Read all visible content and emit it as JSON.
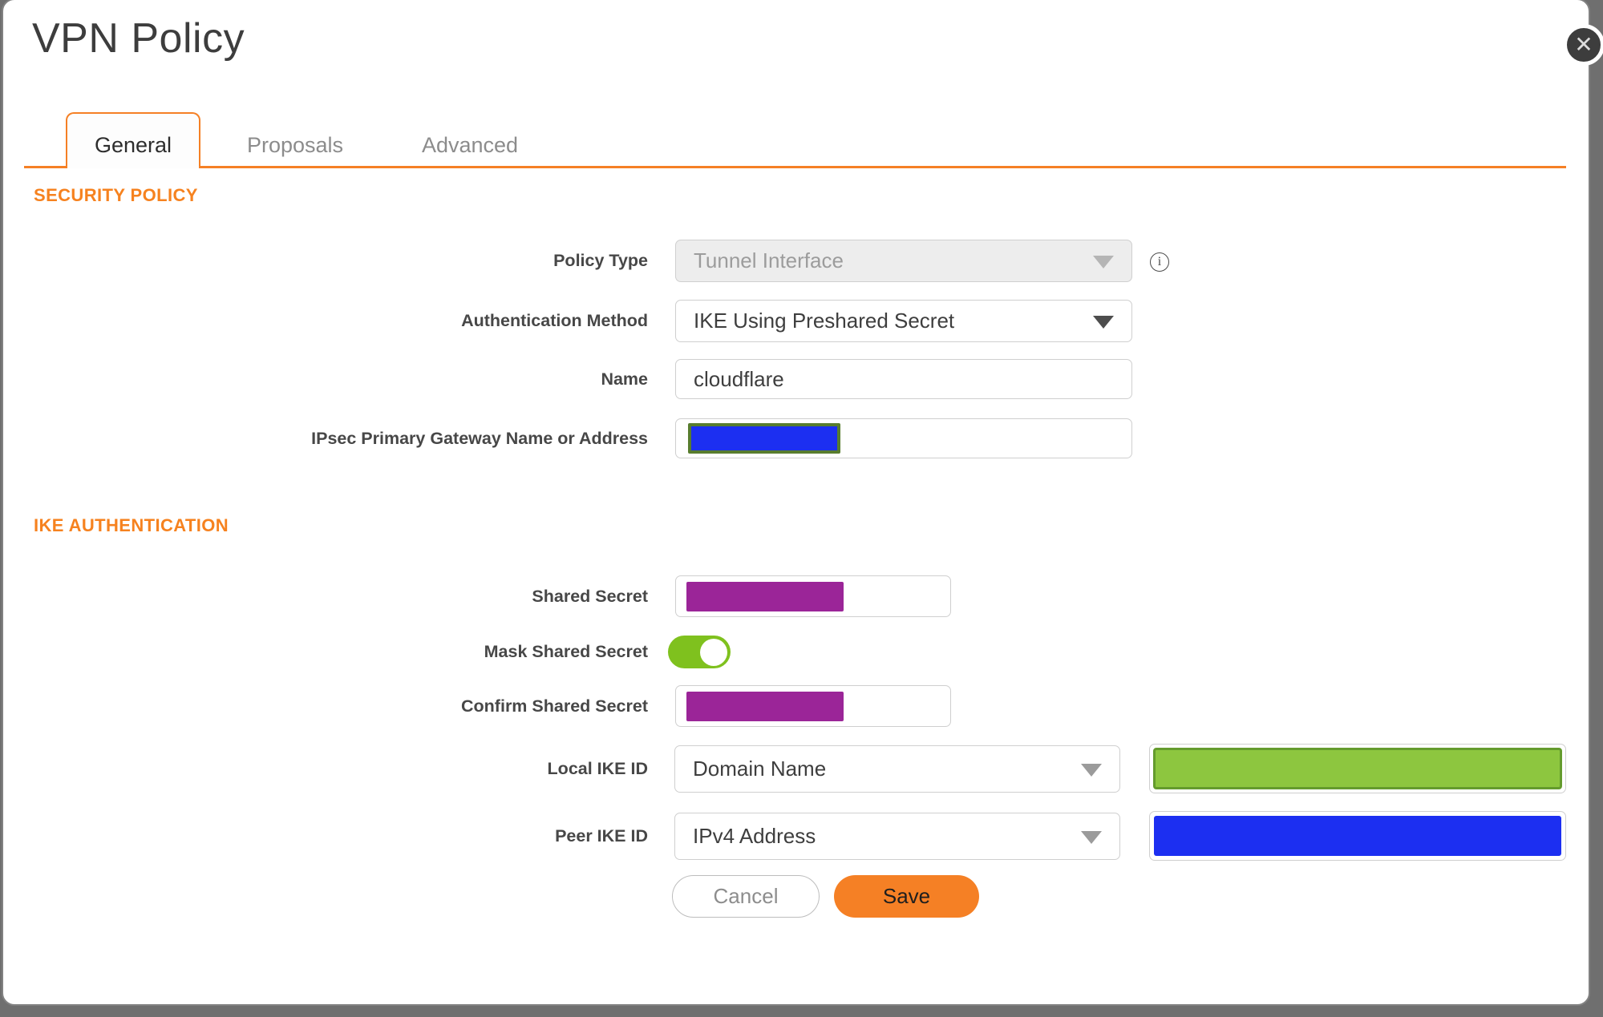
{
  "dialog": {
    "title": "VPN Policy",
    "close_icon": "✕"
  },
  "tabs": [
    {
      "label": "General",
      "active": true
    },
    {
      "label": "Proposals",
      "active": false
    },
    {
      "label": "Advanced",
      "active": false
    }
  ],
  "sections": {
    "security_policy": {
      "heading": "SECURITY POLICY",
      "fields": {
        "policy_type": {
          "label": "Policy Type",
          "value": "Tunnel Interface",
          "disabled": true
        },
        "auth_method": {
          "label": "Authentication Method",
          "value": "IKE Using Preshared Secret"
        },
        "name": {
          "label": "Name",
          "value": "cloudflare"
        },
        "gateway": {
          "label": "IPsec Primary Gateway Name or Address",
          "value": "",
          "redaction": "blue"
        }
      }
    },
    "ike_authentication": {
      "heading": "IKE AUTHENTICATION",
      "fields": {
        "shared_secret": {
          "label": "Shared Secret",
          "redaction": "purple"
        },
        "mask_shared_secret": {
          "label": "Mask Shared Secret",
          "toggle_on": true
        },
        "confirm_shared_secret": {
          "label": "Confirm Shared Secret",
          "redaction": "purple"
        },
        "local_ike_id": {
          "label": "Local IKE ID",
          "value": "Domain Name",
          "redaction": "green"
        },
        "peer_ike_id": {
          "label": "Peer IKE ID",
          "value": "IPv4 Address",
          "redaction": "blue"
        }
      }
    }
  },
  "footer": {
    "cancel_label": "Cancel",
    "save_label": "Save"
  },
  "colors": {
    "accent_orange": "#f58025",
    "heading_orange": "#f6821f",
    "toggle_green": "#7fc11e",
    "redaction_purple": "#9b2598",
    "redaction_blue": "#1c2ff1",
    "redaction_green": "#8dc63f",
    "redaction_green_border": "#649b2d",
    "redaction_olive_border": "#587d2e"
  }
}
